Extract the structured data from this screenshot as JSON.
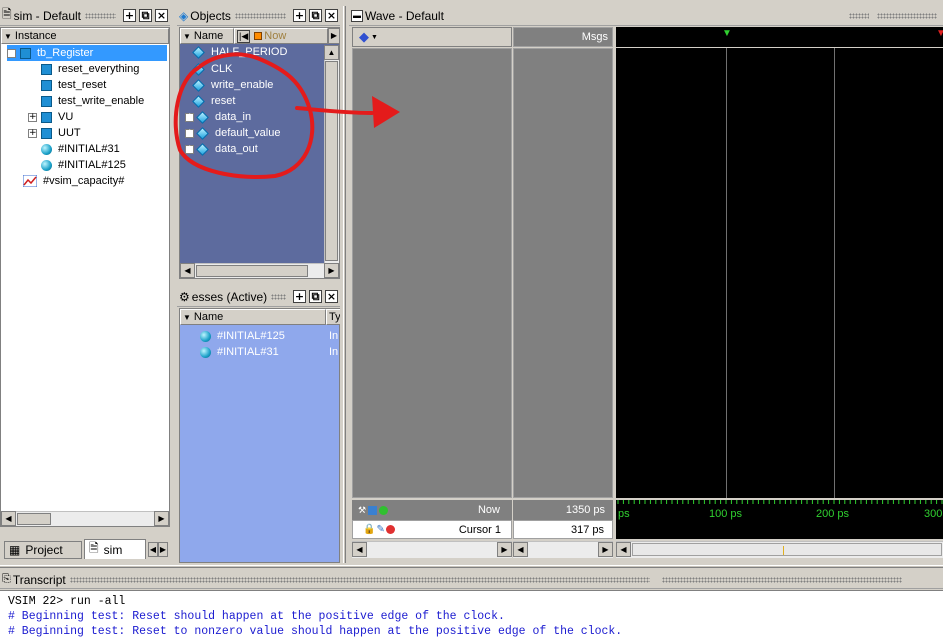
{
  "sim_pane": {
    "title": "sim - Default",
    "column_header": "Instance",
    "items": [
      {
        "label": "tb_Register",
        "selected": true
      },
      {
        "label": "reset_everything"
      },
      {
        "label": "test_reset"
      },
      {
        "label": "test_write_enable"
      },
      {
        "label": "VU"
      },
      {
        "label": "UUT"
      },
      {
        "label": "#INITIAL#31"
      },
      {
        "label": "#INITIAL#125"
      },
      {
        "label": "#vsim_capacity#"
      }
    ],
    "tabs": [
      {
        "label": "Project"
      },
      {
        "label": "sim"
      }
    ]
  },
  "objects_pane": {
    "title": "Objects",
    "col_name": "Name",
    "col_now": "Now",
    "items": [
      {
        "label": "HALF_PERIOD",
        "expand": false
      },
      {
        "label": "CLK",
        "expand": false
      },
      {
        "label": "write_enable",
        "expand": false
      },
      {
        "label": "reset",
        "expand": false
      },
      {
        "label": "data_in",
        "expand": true
      },
      {
        "label": "default_value",
        "expand": true
      },
      {
        "label": "data_out",
        "expand": true
      }
    ]
  },
  "processes_pane": {
    "title": "esses (Active)",
    "col_name": "Name",
    "col_type": "Ty",
    "items": [
      {
        "label": "#INITIAL#125",
        "type": "In"
      },
      {
        "label": "#INITIAL#31",
        "type": "In"
      }
    ]
  },
  "wave_pane": {
    "title": "Wave - Default",
    "msgs_header": "Msgs",
    "now_label": "Now",
    "now_value": "1350 ps",
    "cursor_label": "Cursor 1",
    "cursor_value": "317 ps",
    "time_ticks": [
      "ps",
      "100 ps",
      "200 ps",
      "300"
    ]
  },
  "transcript": {
    "title": "Transcript",
    "lines": [
      {
        "text": "VSIM 22> run -all",
        "kind": "cmd"
      },
      {
        "text": "# Beginning test: Reset should happen at the positive edge of the clock.",
        "kind": "out"
      },
      {
        "text": "# Beginning test: Reset to nonzero value should happen at the positive edge of the clock.",
        "kind": "out"
      }
    ]
  },
  "colors": {
    "pane_bg": "#d4d0c8",
    "objects_bg": "#5d6b9e",
    "processes_bg": "#8fa8ec",
    "selected_row": "#3399ff",
    "wave_bg": "#000000",
    "wave_left_bg": "#808080",
    "annotation": "#e41b1b",
    "transcript_text": "#1b1bd0"
  }
}
